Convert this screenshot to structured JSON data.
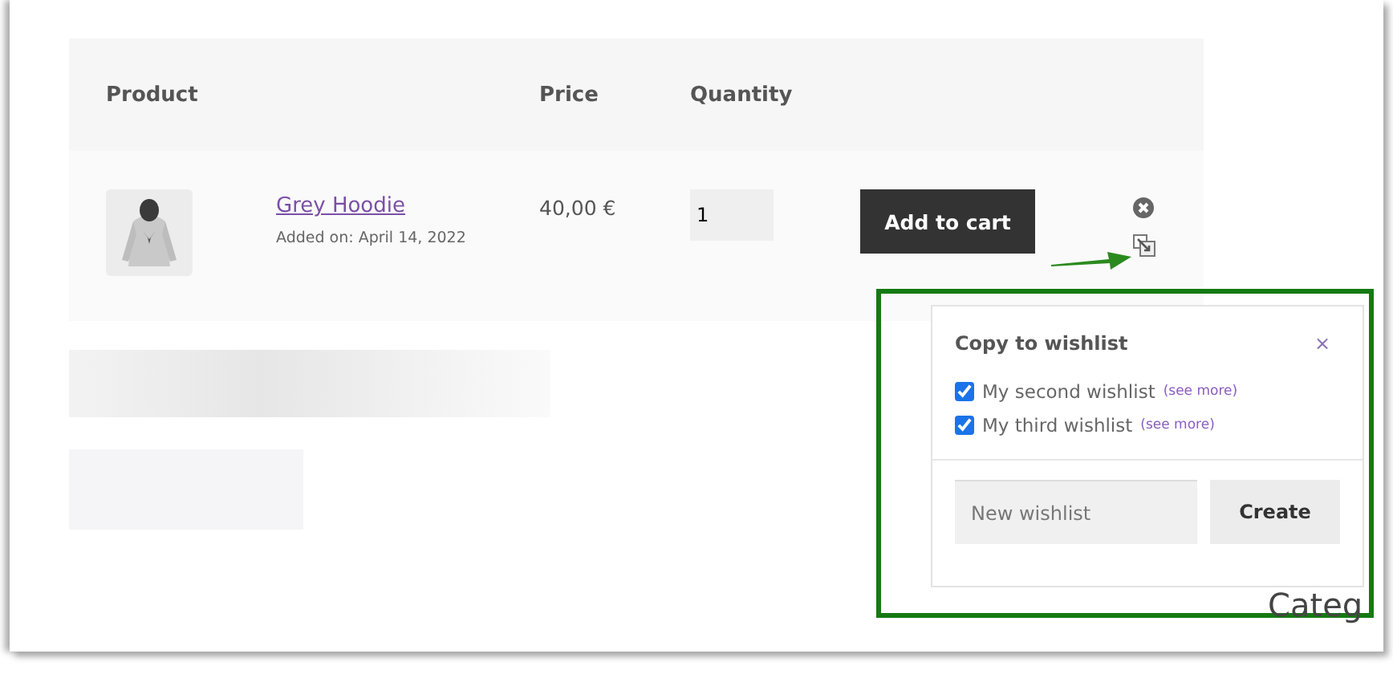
{
  "table": {
    "columns": [
      "Product",
      "Price",
      "Quantity"
    ],
    "rows": [
      {
        "name": "Grey Hoodie",
        "added": "Added on: April 14, 2022",
        "price": "40,00 €",
        "quantity": "1",
        "button": "Add to cart"
      }
    ]
  },
  "sidebar": {
    "heading": "Categ"
  },
  "popup": {
    "title": "Copy to wishlist",
    "close": "×",
    "wishlists": [
      {
        "name": "My second wishlist",
        "link": "(see more)",
        "checked": true
      },
      {
        "name": "My third wishlist",
        "link": "(see more)",
        "checked": true
      }
    ],
    "new_field": {
      "placeholder": "New wishlist"
    },
    "button": "Create"
  }
}
